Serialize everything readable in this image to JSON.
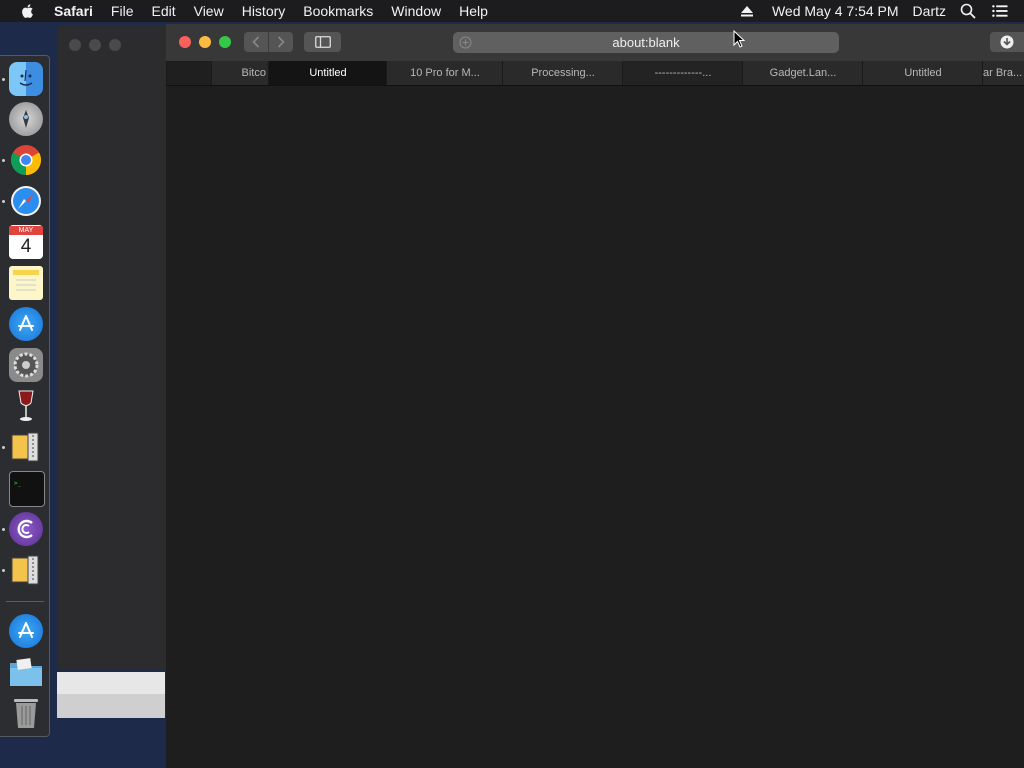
{
  "menubar": {
    "app_name": "Safari",
    "items": [
      "File",
      "Edit",
      "View",
      "History",
      "Bookmarks",
      "Window",
      "Help"
    ],
    "datetime": "Wed May 4  7:54 PM",
    "user": "Dartz",
    "icons": [
      "apple-icon",
      "eject-icon",
      "spotlight-icon",
      "notification-center-icon"
    ]
  },
  "dock": {
    "apps": [
      "Finder",
      "Launchpad",
      "Google Chrome",
      "Safari",
      "Calendar",
      "Notes",
      "App Store",
      "System Preferences",
      "Wine",
      "Archive Utility",
      "Terminal",
      "BitTorrent",
      "Archive Utility",
      "App Store",
      "Downloads",
      "Trash"
    ],
    "calendar_month": "MAY",
    "calendar_day": "4"
  },
  "safari": {
    "url": "about:blank",
    "tabs": [
      {
        "label": ""
      },
      {
        "label": "Bitco"
      },
      {
        "label": "Untitled"
      },
      {
        "label": "10 Pro for M..."
      },
      {
        "label": "Processing..."
      },
      {
        "label": "-------------..."
      },
      {
        "label": "Gadget.Lan..."
      },
      {
        "label": "Untitled"
      },
      {
        "label": "ar Bra..."
      }
    ]
  },
  "colors": {
    "close": "#fc605c",
    "minimize": "#fdbc40",
    "zoom": "#34c84a",
    "active_tab": "#141414"
  }
}
